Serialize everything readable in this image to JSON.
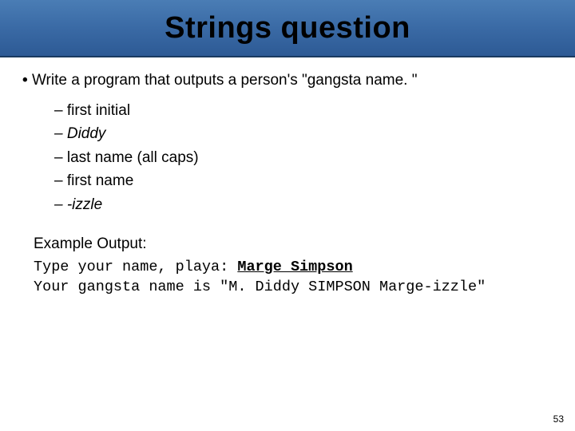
{
  "header": {
    "title": "Strings question"
  },
  "main": {
    "bullet": "Write a program that outputs a person's \"gangsta name. \"",
    "items": [
      {
        "text": "first initial",
        "italic": false
      },
      {
        "text": "Diddy",
        "italic": true
      },
      {
        "text": "last name (all caps)",
        "italic": false
      },
      {
        "text": "first name",
        "italic": false
      },
      {
        "text": "-izzle",
        "italic": true
      }
    ],
    "example_label": "Example Output:",
    "code_line1_prefix": "Type your name, playa: ",
    "code_line1_input": "Marge Simpson",
    "code_line2": "Your gangsta name is \"M. Diddy SIMPSON Marge-izzle\""
  },
  "page_number": "53"
}
